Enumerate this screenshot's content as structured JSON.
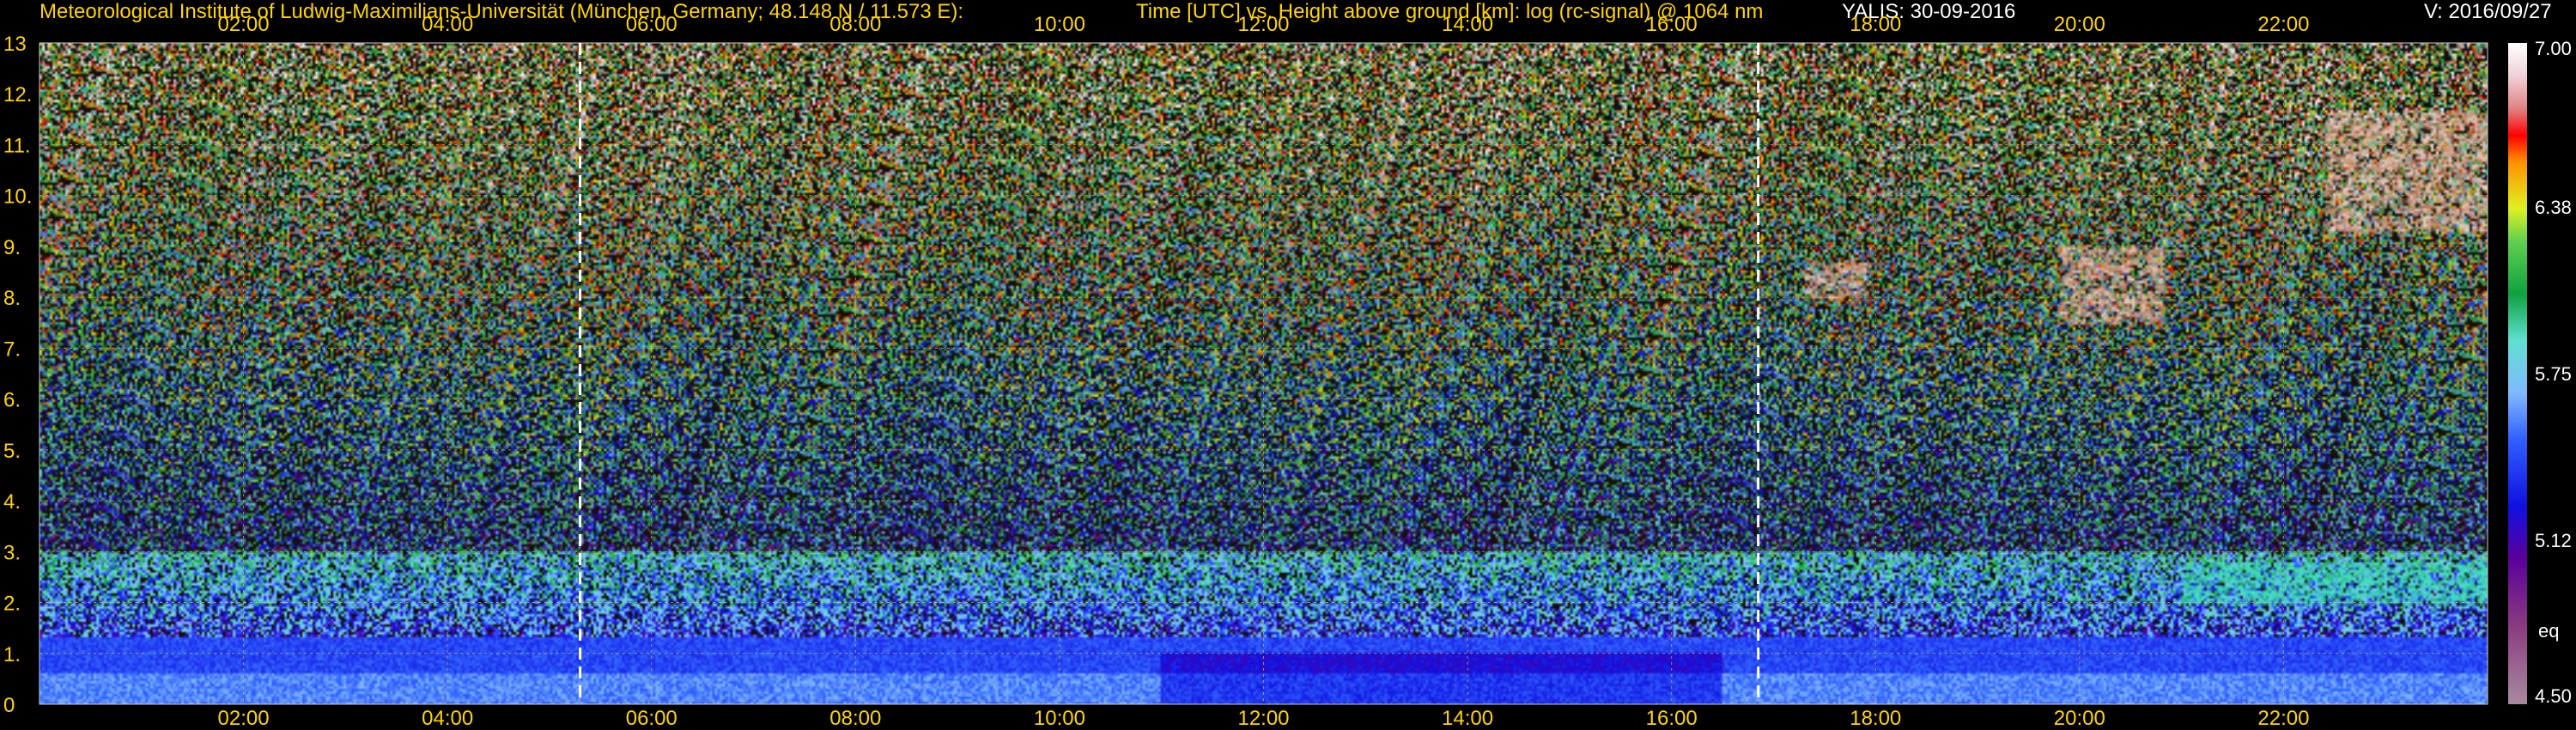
{
  "header": {
    "institute": "Meteorological Institute of Ludwig-Maximilians-Universität (München, Germany; 48.148 N / 11.573 E):",
    "plot_title": "Time [UTC] vs. Height above ground [km]: log (rc-signal) @ 1064 nm",
    "instrument_date": "YALIS: 30-09-2016",
    "version": "V: 2016/09/27"
  },
  "chart_data": {
    "type": "heatmap",
    "title": "Time [UTC] vs. Height above ground [km]: log (rc-signal) @ 1064 nm",
    "x_tick_labels": [
      "02:00",
      "04:00",
      "06:00",
      "08:00",
      "10:00",
      "12:00",
      "14:00",
      "16:00",
      "18:00",
      "20:00",
      "22:00"
    ],
    "x_tick_hours": [
      2,
      4,
      6,
      8,
      10,
      12,
      14,
      16,
      18,
      20,
      22
    ],
    "xlim_hours": [
      0.0,
      24.0
    ],
    "y_tick_labels": [
      "0",
      "1.",
      "2.",
      "3.",
      "4.",
      "5.",
      "6.",
      "7.",
      "8.",
      "9.",
      "10.",
      "11.",
      "12.",
      "13"
    ],
    "ylim_km": [
      0,
      13
    ],
    "grid": true,
    "markers_hours": [
      5.3,
      16.85
    ],
    "colorbar": {
      "range": [
        4.5,
        7.0
      ],
      "tick_labels": [
        "7.00",
        "6.38",
        "5.75",
        "5.12",
        "4.50"
      ],
      "tick_values": [
        7.0,
        6.38,
        5.75,
        5.12,
        4.5
      ],
      "label": "eq"
    },
    "features": [
      {
        "kind": "boundary_layer",
        "height_km": [
          0,
          1.5
        ],
        "hours": [
          0.0,
          24.0
        ],
        "level": "high"
      },
      {
        "kind": "cloud",
        "height_km": [
          8.0,
          8.7
        ],
        "hours": [
          17.3,
          17.9
        ]
      },
      {
        "kind": "cloud",
        "height_km": [
          7.5,
          9.0
        ],
        "hours": [
          19.8,
          20.8
        ]
      },
      {
        "kind": "cloud",
        "height_km": [
          9.3,
          11.7
        ],
        "hours": [
          22.4,
          24.0
        ]
      },
      {
        "kind": "aerosol_layer",
        "height_km": [
          2.0,
          2.8
        ],
        "hours": [
          21.0,
          24.0
        ]
      }
    ]
  }
}
